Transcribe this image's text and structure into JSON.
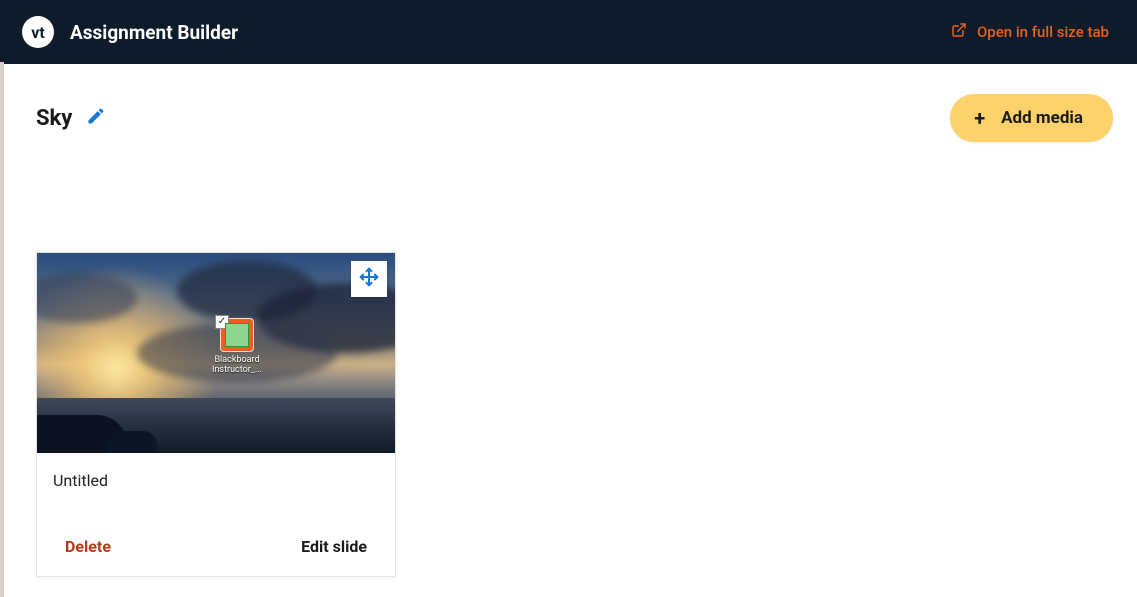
{
  "header": {
    "logo_text": "vt",
    "title": "Assignment Builder",
    "open_label": "Open in full size tab"
  },
  "project": {
    "title": "Sky",
    "add_media_label": "Add media"
  },
  "slides": [
    {
      "title": "Untitled",
      "thumb_desktop_icon_label": "Blackboard Instructor_...",
      "delete_label": "Delete",
      "edit_label": "Edit slide"
    }
  ]
}
